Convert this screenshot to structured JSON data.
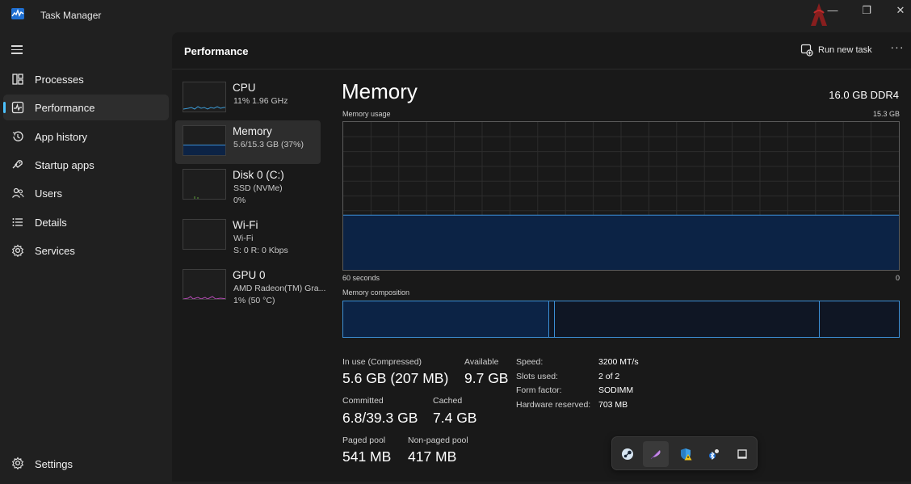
{
  "window": {
    "title": "Task Manager",
    "minimize": "—",
    "maximize": "❐",
    "close": "✕"
  },
  "nav": {
    "items": [
      {
        "label": "Processes",
        "icon": "processes-icon"
      },
      {
        "label": "Performance",
        "icon": "performance-icon",
        "active": true
      },
      {
        "label": "App history",
        "icon": "history-icon"
      },
      {
        "label": "Startup apps",
        "icon": "startup-icon"
      },
      {
        "label": "Users",
        "icon": "users-icon"
      },
      {
        "label": "Details",
        "icon": "details-icon"
      },
      {
        "label": "Services",
        "icon": "services-icon"
      }
    ],
    "settings_label": "Settings"
  },
  "header": {
    "title": "Performance",
    "run_new_task": "Run new task",
    "more": "···"
  },
  "resources": [
    {
      "name": "CPU",
      "line1": "11%  1.96 GHz",
      "line2": ""
    },
    {
      "name": "Memory",
      "line1": "5.6/15.3 GB (37%)",
      "line2": "",
      "active": true
    },
    {
      "name": "Disk 0 (C:)",
      "line1": "SSD (NVMe)",
      "line2": "0%"
    },
    {
      "name": "Wi-Fi",
      "line1": "Wi-Fi",
      "line2": "S: 0  R: 0 Kbps"
    },
    {
      "name": "GPU 0",
      "line1": "AMD Radeon(TM) Gra...",
      "line2": "1%  (50 °C)"
    }
  ],
  "memory": {
    "title": "Memory",
    "spec": "16.0 GB DDR4",
    "usage_label": "Memory usage",
    "usage_max": "15.3 GB",
    "axis_left": "60 seconds",
    "axis_right": "0",
    "usage_fraction": 0.37,
    "composition_label": "Memory composition",
    "stats": {
      "in_use_label": "In use (Compressed)",
      "in_use_value": "5.6 GB (207 MB)",
      "available_label": "Available",
      "available_value": "9.7 GB",
      "committed_label": "Committed",
      "committed_value": "6.8/39.3 GB",
      "cached_label": "Cached",
      "cached_value": "7.4 GB",
      "paged_label": "Paged pool",
      "paged_value": "541 MB",
      "nonpaged_label": "Non-paged pool",
      "nonpaged_value": "417 MB"
    },
    "specs": {
      "speed_label": "Speed:",
      "speed_value": "3200 MT/s",
      "slots_label": "Slots used:",
      "slots_value": "2 of 2",
      "form_label": "Form factor:",
      "form_value": "SODIMM",
      "reserved_label": "Hardware reserved:",
      "reserved_value": "703 MB"
    }
  },
  "tray": {
    "icons": [
      "steam-icon",
      "feather-icon",
      "shield-warning-icon",
      "bluetooth-icon",
      "window-icon"
    ]
  },
  "colors": {
    "accent": "#4cc2ff",
    "memory_fill": "#0c2345",
    "memory_line": "#3c8fd6",
    "background": "#191919",
    "nav_background": "#202020"
  }
}
